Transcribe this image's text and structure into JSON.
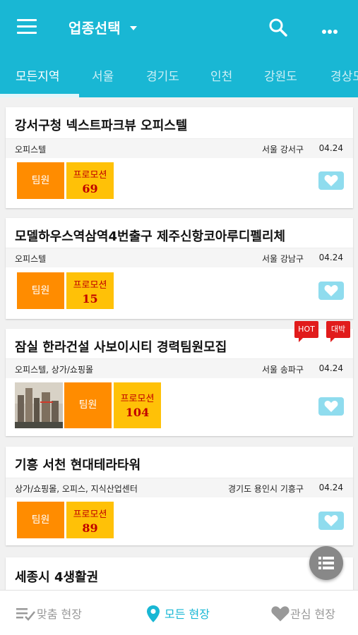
{
  "header": {
    "title": "업종선택",
    "colors": {
      "appbar": "#19b7d4",
      "team_badge": "#ff8c00",
      "promo_badge": "#ffc107",
      "hot_tag": "#e11b1b",
      "heart": "#8fdcee"
    }
  },
  "tabs": [
    {
      "label": "모든지역"
    },
    {
      "label": "서울"
    },
    {
      "label": "경기도"
    },
    {
      "label": "인천"
    },
    {
      "label": "강원도"
    },
    {
      "label": "경상도"
    }
  ],
  "listings": [
    {
      "title": "강서구청 넥스트파크뷰 오피스텔",
      "category": "오피스텔",
      "location": "서울 강서구",
      "date": "04.24",
      "team_label": "팀원",
      "promo_label": "프로모션",
      "promo_value": "69"
    },
    {
      "title": "모델하우스역삼역4번출구 제주신항코아루디펠리체",
      "category": "오피스텔",
      "location": "서울 강남구",
      "date": "04.24",
      "team_label": "팀원",
      "promo_label": "프로모션",
      "promo_value": "15"
    },
    {
      "title": "잠실 한라건설 사보이시티 경력팀원모집",
      "category": "오피스텔, 상가/쇼핑몰",
      "location": "서울 송파구",
      "date": "04.24",
      "team_label": "팀원",
      "promo_label": "프로모션",
      "promo_value": "104",
      "tags": [
        "HOT",
        "대박"
      ]
    },
    {
      "title": "기흥 서천 현대테라타워",
      "category": "상가/쇼핑몰, 오피스, 지식산업센터",
      "location": "경기도 용인시 기흥구",
      "date": "04.24",
      "team_label": "팀원",
      "promo_label": "프로모션",
      "promo_value": "89"
    },
    {
      "title": "세종시 4생활권"
    }
  ],
  "bottom_nav": [
    {
      "label": "맞춤 현장",
      "icon": "checklist-icon"
    },
    {
      "label": "모든 현장",
      "icon": "location-pin-icon"
    },
    {
      "label": "관심 현장",
      "icon": "heart-icon"
    }
  ]
}
